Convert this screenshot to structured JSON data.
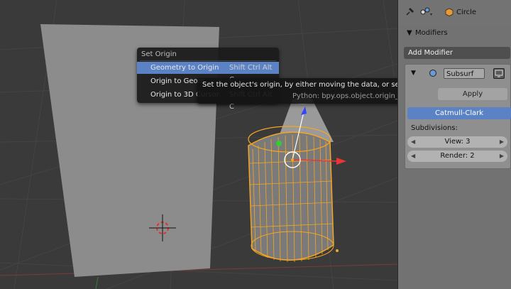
{
  "menu": {
    "title": "Set Origin",
    "items": [
      {
        "label": "Geometry to Origin",
        "shortcut": "Shift Ctrl Alt C"
      },
      {
        "label": "Origin to Geom",
        "shortcut": ""
      },
      {
        "label": "Origin to 3D Cursor",
        "shortcut": "Shift Ctrl Alt C"
      }
    ]
  },
  "tooltip": {
    "description": "Set the object's origin, by either moving the data, or set to center of data, or use 3d cursor",
    "python": "Python: bpy.ops.object.origin_set()"
  },
  "panel": {
    "object_name": "Circle",
    "section": "Modifiers",
    "add_modifier": "Add Modifier",
    "modifier_name": "Subsurf",
    "apply": "Apply",
    "algorithm": "Catmull-Clark",
    "subdivisions_label": "Subdivisions:",
    "view": "View: 3",
    "render": "Render: 2"
  },
  "icons": {
    "pin": "pin-icon",
    "link": "link-icon",
    "object": "object-cube-icon",
    "collapse": "triangle-down-icon",
    "modifier_type": "subsurf-icon",
    "display_toggle": "display-icon"
  },
  "colors": {
    "highlight": "#5b82c4",
    "selection": "#f5a623",
    "axis_x": "#e33",
    "axis_y": "#3c3",
    "axis_z": "#33f"
  }
}
